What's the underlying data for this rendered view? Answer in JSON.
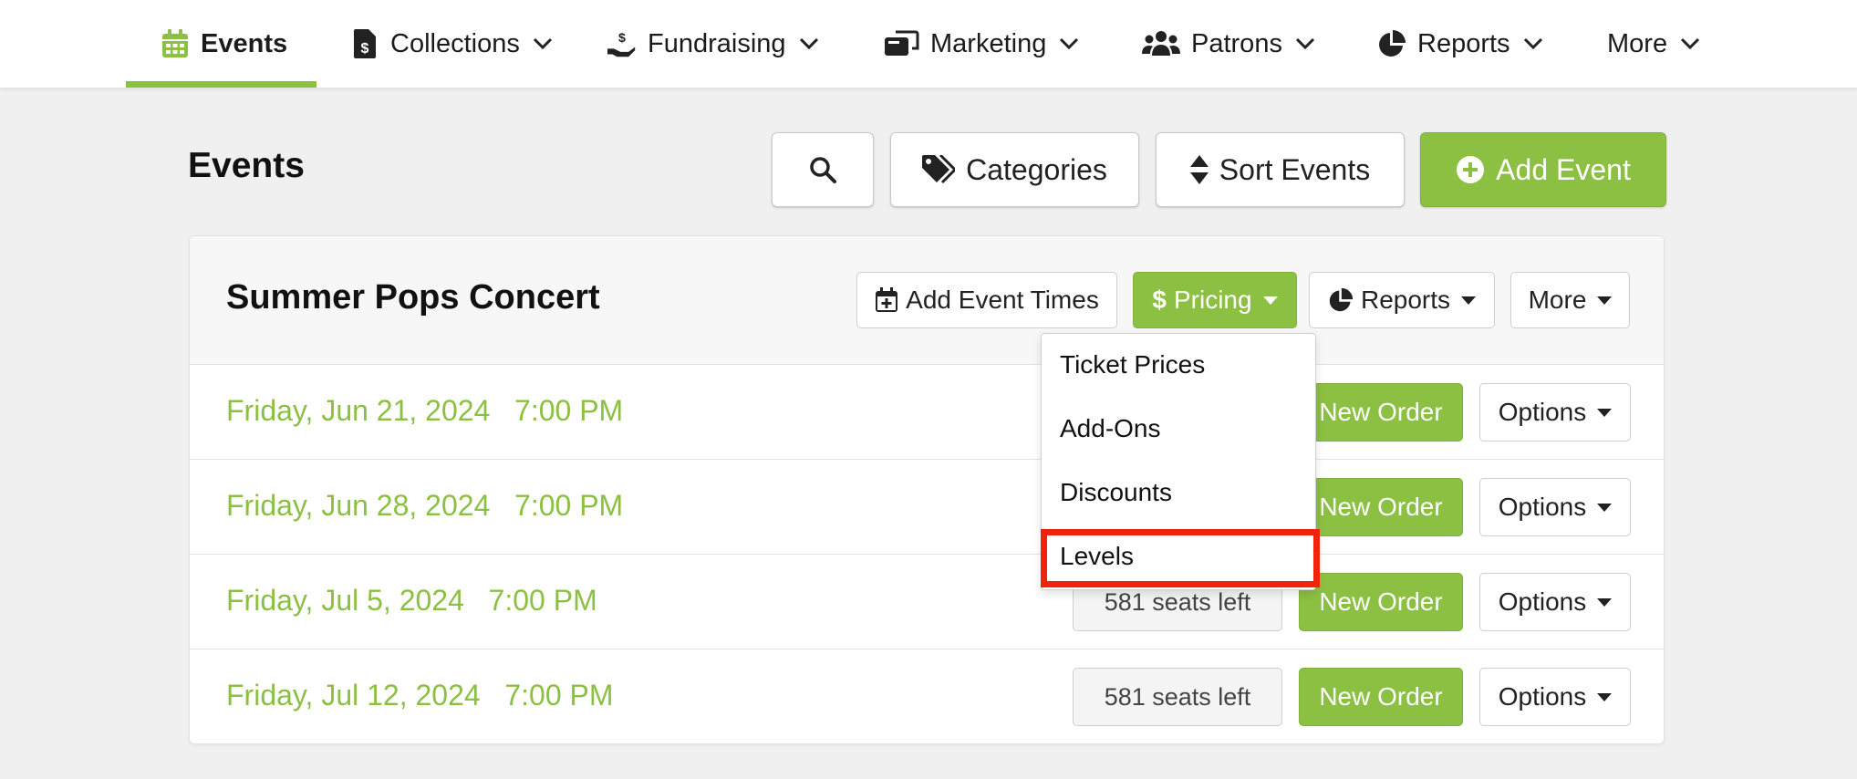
{
  "nav": {
    "items": [
      {
        "label": "Events",
        "icon": "calendar-icon"
      },
      {
        "label": "Collections",
        "icon": "dollar-file-icon"
      },
      {
        "label": "Fundraising",
        "icon": "hand-dollar-icon"
      },
      {
        "label": "Marketing",
        "icon": "mailbox-icon"
      },
      {
        "label": "Patrons",
        "icon": "users-icon"
      },
      {
        "label": "Reports",
        "icon": "pie-chart-icon"
      },
      {
        "label": "More",
        "icon": ""
      }
    ],
    "active": "Events"
  },
  "header": {
    "title": "Events",
    "categories_label": "Categories",
    "sort_label": "Sort Events",
    "add_label": "Add Event"
  },
  "event": {
    "title": "Summer Pops Concert",
    "add_times_label": "Add Event Times",
    "pricing_label": "Pricing",
    "reports_label": "Reports",
    "more_label": "More",
    "rows": [
      {
        "date": "Friday, Jun 21, 2024",
        "time": "7:00 PM",
        "seats": "",
        "order_label": "New Order",
        "options_label": "Options"
      },
      {
        "date": "Friday, Jun 28, 2024",
        "time": "7:00 PM",
        "seats": "",
        "order_label": "New Order",
        "options_label": "Options"
      },
      {
        "date": "Friday, Jul 5, 2024",
        "time": "7:00 PM",
        "seats": "581 seats left",
        "order_label": "New Order",
        "options_label": "Options"
      },
      {
        "date": "Friday, Jul 12, 2024",
        "time": "7:00 PM",
        "seats": "581 seats left",
        "order_label": "New Order",
        "options_label": "Options"
      }
    ]
  },
  "pricing_menu": {
    "items": [
      "Ticket Prices",
      "Add-Ons",
      "Discounts",
      "Levels"
    ],
    "highlighted": "Levels"
  },
  "colors": {
    "accent": "#8cc043",
    "highlight": "#f0240a",
    "background": "#f0f0f0"
  }
}
